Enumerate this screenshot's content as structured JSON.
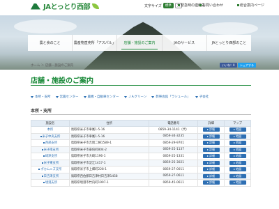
{
  "header": {
    "logo_text": "JAとっとり西部",
    "logo_sub": "TOTTORI SEIBU",
    "font_size_label": "文字サイズ",
    "font_size_options": [
      "標準",
      "大"
    ],
    "links": [
      "緊急時の連絡先",
      "お問い合わせ",
      "総合案内ページ"
    ]
  },
  "nav": {
    "items": [
      "農と食のこと",
      "農産物直売所「アスパル」",
      "店舗・施設のご案内",
      "JAのサービス",
      "JAとっとり西部のこと"
    ],
    "active_index": 2
  },
  "breadcrumb": "ホーム ＞ 店舗・施設のご案内",
  "share": {
    "facebook": "いいね！0",
    "twitter": "シェアする"
  },
  "page_title": "店舗・施設のご案内",
  "anchors": [
    "本所・支所",
    "営農センター",
    "農機・自動車センター",
    "ＪＡグリーン",
    "葬祭会館「ラシュール」",
    "子会社"
  ],
  "section": {
    "title": "本所・支所",
    "columns": [
      "施設名",
      "住所",
      "電話番号",
      "詳細",
      "マップ"
    ],
    "rows": [
      {
        "name": "本所",
        "address": "鳥取県米子市車尾1-5-16",
        "tel": "0859-34-1141（代）"
      },
      {
        "name": "米子中央支所",
        "address": "鳥取県米子市車尾1-5-16",
        "tel": "0859-34-3235"
      },
      {
        "name": "西部支所",
        "address": "鳥取県米子市吉岡二條1589-1",
        "tel": "0859-29-9701"
      },
      {
        "name": "米子南支所",
        "address": "鳥取県米子市安倍町804-2",
        "tel": "0859-25-1137"
      },
      {
        "name": "崎津支所",
        "address": "鳥取県米子市大崎1196-1",
        "tel": "0859-25-1331"
      },
      {
        "name": "米子東支所",
        "address": "鳥取県米子市淀江1417-1",
        "tel": "0859-25-3021"
      },
      {
        "name": "ポカムニズ支所",
        "address": "鳥取県米子市上畑町228-1",
        "tel": "0859-27-0011"
      },
      {
        "name": "日吉津支所",
        "address": "鳥取県西伯郡日吉津村日吉津1458",
        "tel": "0859-27-0611"
      },
      {
        "name": "境港支所",
        "address": "鳥取県境港市竹内町1997-1",
        "tel": "0859-45-0611"
      }
    ],
    "detail_label": "詳細",
    "map_label": "地図"
  }
}
